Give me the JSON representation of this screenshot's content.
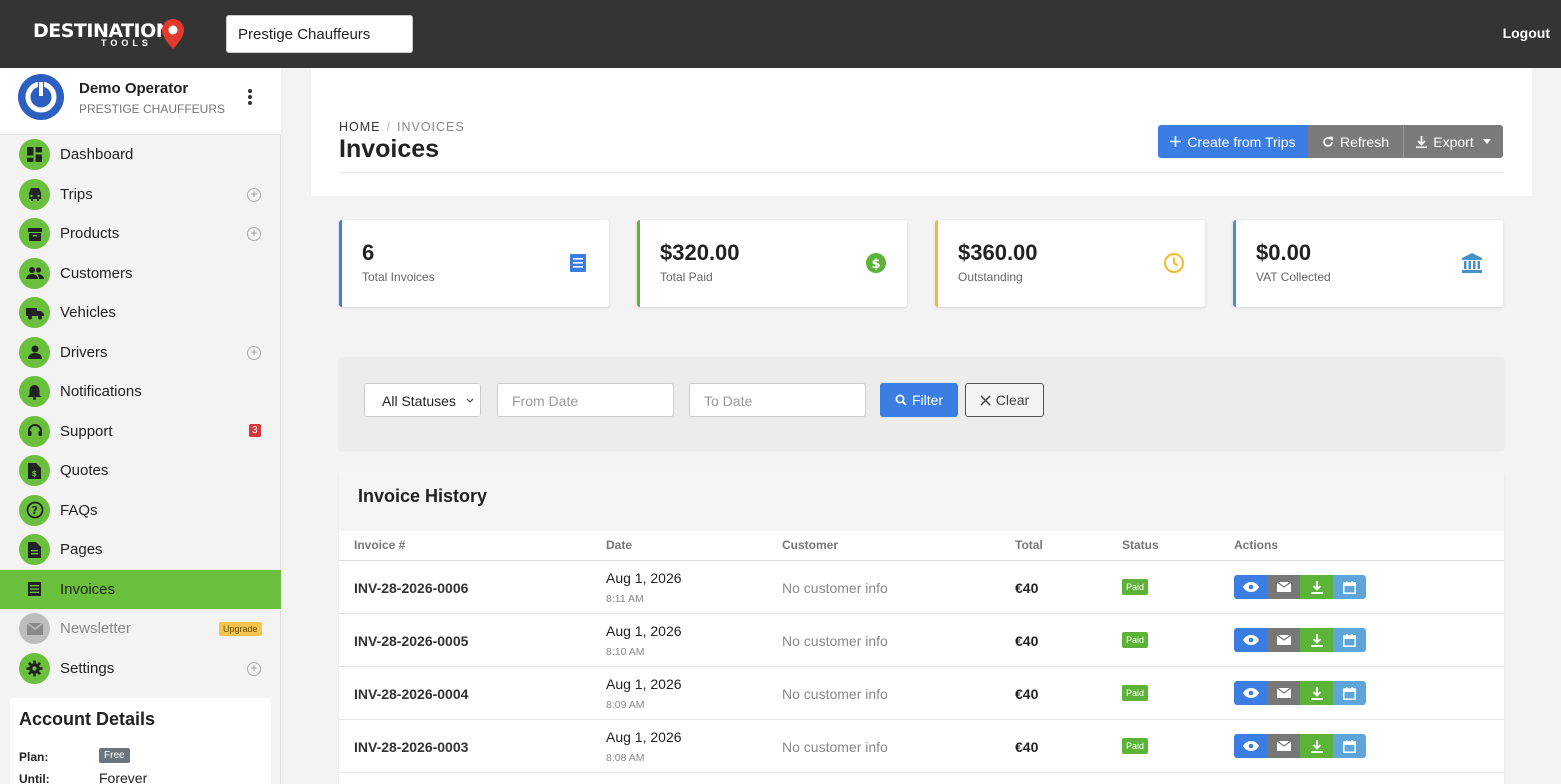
{
  "topbar": {
    "logo_text": "DESTINATION",
    "logo_sub": "TOOLS",
    "company_select": "Prestige Chauffeurs",
    "logout_label": "Logout"
  },
  "user": {
    "name": "Demo Operator",
    "company": "PRESTIGE CHAUFFEURS"
  },
  "nav": [
    {
      "label": "Dashboard",
      "icon": "dashboard-icon"
    },
    {
      "label": "Trips",
      "icon": "car-icon",
      "plus": true
    },
    {
      "label": "Products",
      "icon": "archive-icon",
      "plus": true
    },
    {
      "label": "Customers",
      "icon": "users-icon"
    },
    {
      "label": "Vehicles",
      "icon": "truck-icon"
    },
    {
      "label": "Drivers",
      "icon": "person-icon",
      "plus": true
    },
    {
      "label": "Notifications",
      "icon": "bell-icon"
    },
    {
      "label": "Support",
      "icon": "headset-icon",
      "badge": "3"
    },
    {
      "label": "Quotes",
      "icon": "document-dollar-icon"
    },
    {
      "label": "FAQs",
      "icon": "question-icon"
    },
    {
      "label": "Pages",
      "icon": "page-icon"
    },
    {
      "label": "Invoices",
      "icon": "receipt-icon",
      "active": true
    },
    {
      "label": "Newsletter",
      "icon": "mail-icon",
      "badge": "Upgrade",
      "disabled": true
    },
    {
      "label": "Settings",
      "icon": "gear-icon",
      "plus": true
    }
  ],
  "account": {
    "title": "Account Details",
    "plan_label": "Plan:",
    "plan_value": "Free",
    "until_label": "Until:",
    "until_value": "Forever"
  },
  "header": {
    "breadcrumb_home": "HOME",
    "breadcrumb_current": "INVOICES",
    "title": "Invoices",
    "create_label": "Create from Trips",
    "refresh_label": "Refresh",
    "export_label": "Export"
  },
  "stats": [
    {
      "value": "6",
      "label": "Total Invoices",
      "color": "#3b7de3",
      "icon": "receipt-icon"
    },
    {
      "value": "$320.00",
      "label": "Total Paid",
      "color": "#5cb338",
      "icon": "dollar-circle-icon"
    },
    {
      "value": "$360.00",
      "label": "Outstanding",
      "color": "#f5b82e",
      "icon": "clock-icon"
    },
    {
      "value": "$0.00",
      "label": "VAT Collected",
      "color": "#4a8fc7",
      "icon": "bank-icon"
    }
  ],
  "filter": {
    "status_value": "All Statuses",
    "from_placeholder": "From Date",
    "to_placeholder": "To Date",
    "filter_label": "Filter",
    "clear_label": "Clear"
  },
  "table": {
    "title": "Invoice History",
    "columns": [
      "Invoice #",
      "Date",
      "Customer",
      "Total",
      "Status",
      "Actions"
    ],
    "rows": [
      {
        "invoice": "INV-28-2026-0006",
        "date": "Aug 1, 2026",
        "time": "8:11 AM",
        "customer": "No customer info",
        "total": "€40",
        "status": "Paid"
      },
      {
        "invoice": "INV-28-2026-0005",
        "date": "Aug 1, 2026",
        "time": "8:10 AM",
        "customer": "No customer info",
        "total": "€40",
        "status": "Paid"
      },
      {
        "invoice": "INV-28-2026-0004",
        "date": "Aug 1, 2026",
        "time": "8:09 AM",
        "customer": "No customer info",
        "total": "€40",
        "status": "Paid"
      },
      {
        "invoice": "INV-28-2026-0003",
        "date": "Aug 1, 2026",
        "time": "8:08 AM",
        "customer": "No customer info",
        "total": "€40",
        "status": "Paid"
      }
    ]
  },
  "colors": {
    "brand_green": "#6abf3c",
    "primary_blue": "#3b7de3",
    "topbar": "#343434"
  }
}
